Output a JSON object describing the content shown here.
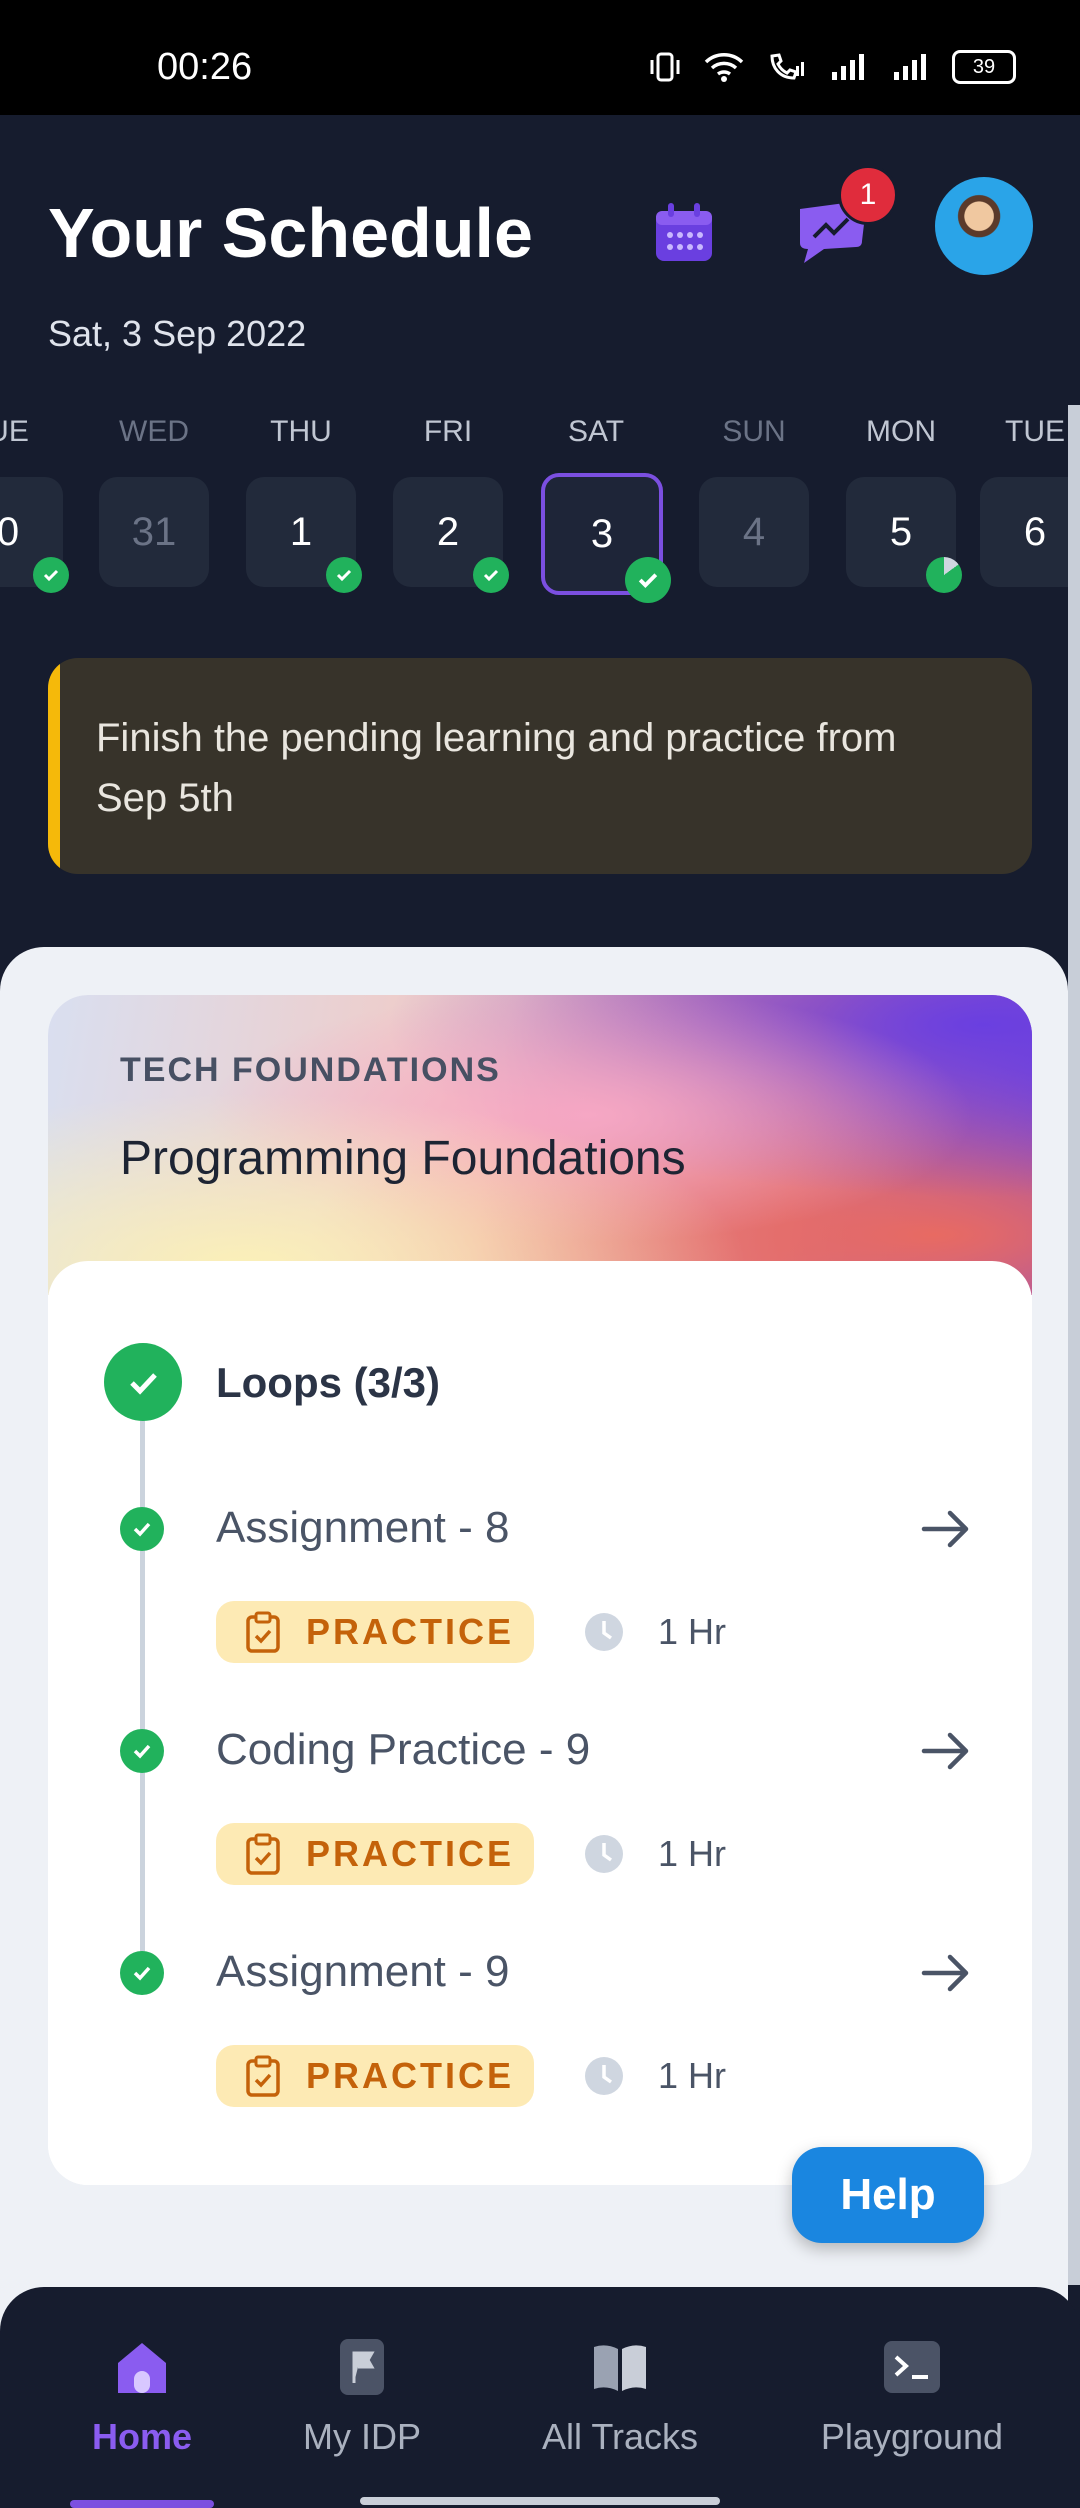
{
  "status": {
    "time": "00:26",
    "battery": "39"
  },
  "header": {
    "title": "Your Schedule",
    "date": "Sat, 3 Sep 2022",
    "notification_count": "1"
  },
  "days": [
    {
      "label": "UE",
      "num": "0",
      "state": "done"
    },
    {
      "label": "WED",
      "num": "31",
      "state": "none"
    },
    {
      "label": "THU",
      "num": "1",
      "state": "done"
    },
    {
      "label": "FRI",
      "num": "2",
      "state": "done"
    },
    {
      "label": "SAT",
      "num": "3",
      "state": "done-selected"
    },
    {
      "label": "SUN",
      "num": "4",
      "state": "none"
    },
    {
      "label": "MON",
      "num": "5",
      "state": "partial"
    },
    {
      "label": "TUE",
      "num": "6",
      "state": "partial-edge"
    }
  ],
  "notice": {
    "text": "Finish the pending learning and practice from Sep 5th"
  },
  "card": {
    "eyebrow": "TECH FOUNDATIONS",
    "course": "Programming Foundations",
    "topic": "Loops (3/3)",
    "items": [
      {
        "title": "Assignment - 8",
        "tag": "PRACTICE",
        "duration": "1 Hr"
      },
      {
        "title": "Coding Practice - 9",
        "tag": "PRACTICE",
        "duration": "1 Hr"
      },
      {
        "title": "Assignment - 9",
        "tag": "PRACTICE",
        "duration": "1 Hr"
      }
    ]
  },
  "help": {
    "label": "Help"
  },
  "nav": [
    {
      "label": "Home",
      "icon": "home-icon",
      "active": true
    },
    {
      "label": "My IDP",
      "icon": "flag-document-icon",
      "active": false
    },
    {
      "label": "All Tracks",
      "icon": "open-book-icon",
      "active": false
    },
    {
      "label": "Playground",
      "icon": "terminal-icon",
      "active": false
    }
  ],
  "colors": {
    "accent": "#7b4fe0",
    "success": "#21b25c",
    "warning_bar": "#f5b90a",
    "help": "#1a86e0"
  }
}
